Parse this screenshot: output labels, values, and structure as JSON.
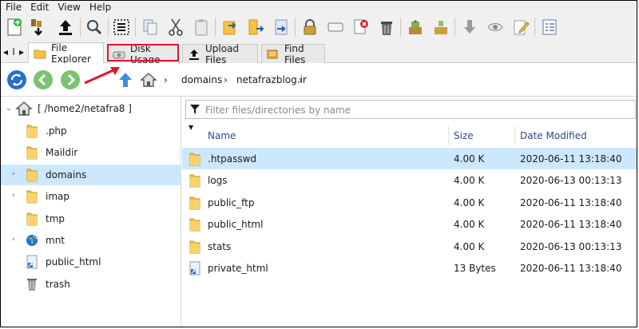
{
  "menu": [
    "File",
    "Edit",
    "View",
    "Help"
  ],
  "toolbar": {
    "buttons": [
      {
        "name": "new-file-icon"
      },
      {
        "name": "download-icon"
      },
      {
        "name": "upload-icon"
      },
      {
        "name": "search-icon"
      },
      {
        "name": "select-all-icon"
      },
      {
        "name": "copy-icon"
      },
      {
        "name": "cut-icon"
      },
      {
        "name": "paste-icon"
      },
      {
        "name": "move-icon"
      },
      {
        "name": "copy-to-icon"
      },
      {
        "name": "rename-icon"
      },
      {
        "name": "permissions-icon"
      },
      {
        "name": "compress-icon"
      },
      {
        "name": "delete-permanently-icon"
      },
      {
        "name": "trash-icon"
      },
      {
        "name": "extract-icon"
      },
      {
        "name": "archive-icon"
      },
      {
        "name": "download-arrow-icon"
      },
      {
        "name": "view-icon"
      },
      {
        "name": "edit-icon"
      },
      {
        "name": "html-editor-icon"
      }
    ]
  },
  "tabs": [
    {
      "label": "File Explorer",
      "active": true
    },
    {
      "label": "Disk Usage",
      "active": false
    },
    {
      "label": "Upload Files",
      "active": false
    },
    {
      "label": "Find Files",
      "active": false
    }
  ],
  "breadcrumb": [
    "domains",
    "netafrazblog.ir"
  ],
  "tree": {
    "root": "[ /home2/netafra8 ]",
    "items": [
      {
        "label": ".php",
        "icon": "folder-icon",
        "expandable": false,
        "selected": false
      },
      {
        "label": "Maildir",
        "icon": "folder-icon",
        "expandable": false,
        "selected": false
      },
      {
        "label": "domains",
        "icon": "folder-icon",
        "expandable": true,
        "selected": true
      },
      {
        "label": "imap",
        "icon": "folder-icon",
        "expandable": true,
        "selected": false
      },
      {
        "label": "tmp",
        "icon": "folder-icon",
        "expandable": false,
        "selected": false
      },
      {
        "label": "mnt",
        "icon": "globe-icon",
        "expandable": true,
        "selected": false
      },
      {
        "label": "public_html",
        "icon": "link-icon",
        "expandable": false,
        "selected": false
      },
      {
        "label": "trash",
        "icon": "trash-icon",
        "expandable": false,
        "selected": false
      }
    ]
  },
  "filter": {
    "placeholder": "Filter files/directories by name"
  },
  "columns": {
    "name": "Name",
    "size": "Size",
    "modified": "Date Modified"
  },
  "files": [
    {
      "name": ".htpasswd",
      "icon": "folder-icon",
      "size": "4.00 K",
      "modified": "2020-06-11 13:18:40",
      "selected": true
    },
    {
      "name": "logs",
      "icon": "folder-icon",
      "size": "4.00 K",
      "modified": "2020-06-13 00:13:13",
      "selected": false
    },
    {
      "name": "public_ftp",
      "icon": "folder-icon",
      "size": "4.00 K",
      "modified": "2020-06-11 13:18:40",
      "selected": false
    },
    {
      "name": "public_html",
      "icon": "folder-icon",
      "size": "4.00 K",
      "modified": "2020-06-11 13:18:40",
      "selected": false
    },
    {
      "name": "stats",
      "icon": "folder-icon",
      "size": "4.00 K",
      "modified": "2020-06-13 00:13:13",
      "selected": false
    },
    {
      "name": "private_html",
      "icon": "link-icon",
      "size": "13 Bytes",
      "modified": "2020-06-11 13:18:40",
      "selected": false
    }
  ],
  "colors": {
    "selection": "#cce8ff",
    "annotation": "#e0142a",
    "folder": "#f5c342"
  }
}
